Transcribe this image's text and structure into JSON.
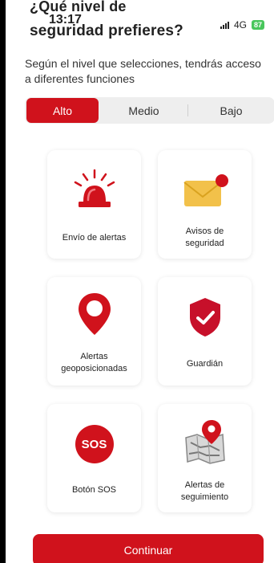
{
  "header": {
    "title_line1": "¿Qué nivel de",
    "title_line2": "seguridad prefieres?",
    "time": "13:17",
    "network": "4G",
    "battery": "87"
  },
  "subtitle": "Según el nivel que selecciones, tendrás acceso a diferentes funciones",
  "levels": {
    "options": [
      "Alto",
      "Medio",
      "Bajo"
    ],
    "selected": "Alto"
  },
  "features": [
    {
      "label": "Envío de alertas",
      "icon": "siren-icon"
    },
    {
      "label": "Avisos de\nseguridad",
      "icon": "mail-icon",
      "badge": "1"
    },
    {
      "label": "Alertas\ngeoposicionadas",
      "icon": "location-pin-icon"
    },
    {
      "label": "Guardián",
      "icon": "shield-check-icon"
    },
    {
      "label": "Botón SOS",
      "icon": "sos-icon",
      "icon_text": "SOS"
    },
    {
      "label": "Alertas de\nseguimiento",
      "icon": "map-pin-icon"
    }
  ],
  "continue_label": "Continuar",
  "colors": {
    "accent": "#d0121c",
    "envelope": "#f2c14a"
  }
}
